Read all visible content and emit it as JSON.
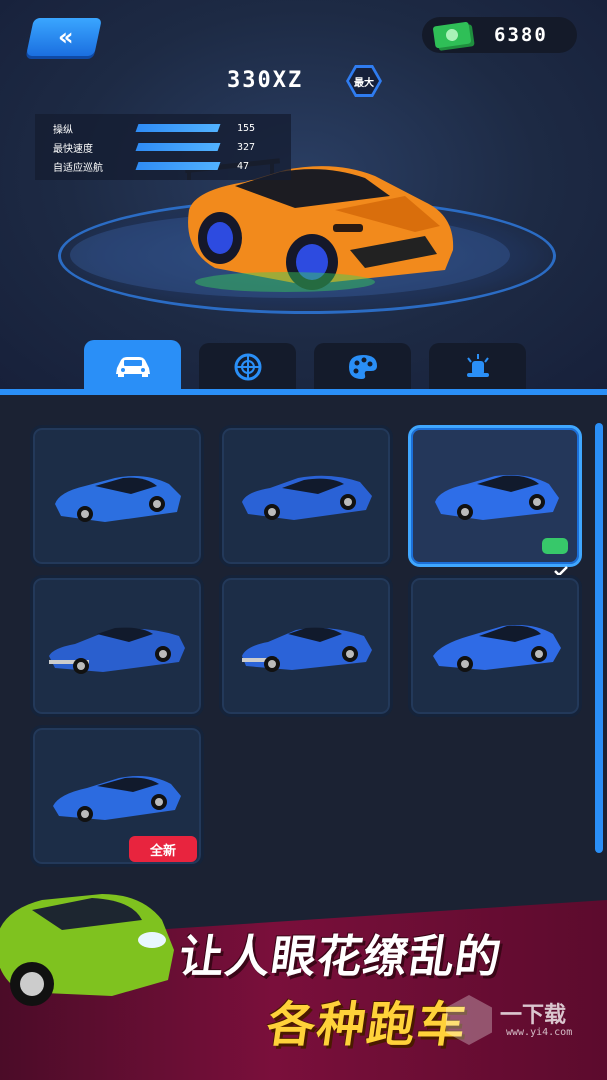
{
  "header": {
    "back_label": "«",
    "money": "6380",
    "car_name": "330XZ",
    "max_badge": "最大"
  },
  "stats": [
    {
      "label": "操纵",
      "value": "155"
    },
    {
      "label": "最快速度",
      "value": "327"
    },
    {
      "label": "自适应巡航",
      "value": "47"
    }
  ],
  "tabs": [
    {
      "name": "car-icon",
      "active": true
    },
    {
      "name": "wheel-icon",
      "active": false
    },
    {
      "name": "palette-icon",
      "active": false
    },
    {
      "name": "spoiler-light-icon",
      "active": false
    }
  ],
  "cars": [
    {
      "id": 1,
      "selected": false,
      "badge": ""
    },
    {
      "id": 2,
      "selected": false,
      "badge": ""
    },
    {
      "id": 3,
      "selected": true,
      "badge": ""
    },
    {
      "id": 4,
      "selected": false,
      "badge": ""
    },
    {
      "id": 5,
      "selected": false,
      "badge": ""
    },
    {
      "id": 6,
      "selected": false,
      "badge": ""
    },
    {
      "id": 7,
      "selected": false,
      "badge": "全新"
    }
  ],
  "banner": {
    "line1": "让人眼花缭乱的",
    "line2": "各种跑车"
  },
  "watermark": {
    "text": "一下载",
    "url": "www.yi4.com"
  },
  "colors": {
    "accent": "#2a8ff7",
    "card_bg": "#1c2d47",
    "new_badge": "#e8243e",
    "check": "#37c86a",
    "banner_text_yellow": "#ffd23a"
  }
}
